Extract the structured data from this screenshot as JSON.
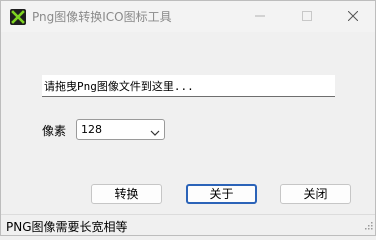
{
  "window": {
    "title": "Png图像转换ICO图标工具"
  },
  "main": {
    "drop_field_text": "请拖曳Png图像文件到这里...",
    "pixel_label": "像素",
    "pixel_value": "128"
  },
  "buttons": {
    "convert": "转换",
    "about": "关于",
    "close": "关闭"
  },
  "status": {
    "text": "PNG图像需要长宽相等"
  },
  "icons": {
    "app": "app-logo-icon",
    "minimize": "minimize-icon",
    "maximize": "maximize-icon",
    "close": "close-icon",
    "dropdown": "chevron-down-icon",
    "resize": "resize-grip-icon"
  },
  "colors": {
    "accent": "#2b63b8"
  }
}
